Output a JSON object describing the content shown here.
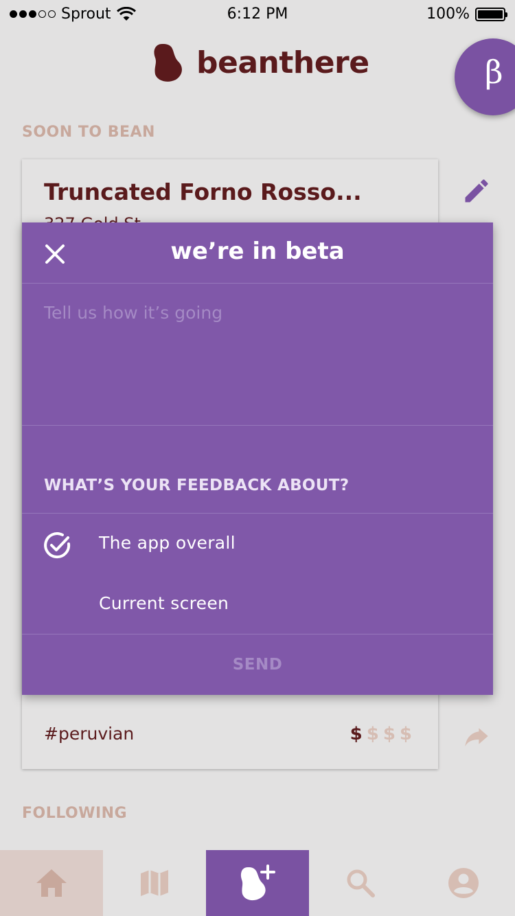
{
  "status_bar": {
    "carrier": "Sprout",
    "time": "6:12 PM",
    "battery": "100%"
  },
  "header": {
    "app_name": "beanthere",
    "beta_badge": "β"
  },
  "sections": {
    "soon_to_bean": "SOON TO BEAN",
    "following": "FOLLOWING"
  },
  "card": {
    "title": "Truncated Forno Rosso...",
    "subtitle": "327 Gold St",
    "tag": "#peruvian",
    "price_level": 1,
    "price_max": 4,
    "price_symbol": "$"
  },
  "feedback_modal": {
    "title": "we’re in beta",
    "input_placeholder": "Tell us how it’s going",
    "input_value": "",
    "question": "WHAT’S YOUR FEEDBACK ABOUT?",
    "options": [
      {
        "label": "The app overall",
        "selected": true
      },
      {
        "label": "Current screen",
        "selected": false
      }
    ],
    "send_label": "SEND"
  },
  "tabbar": {
    "items": [
      {
        "name": "home",
        "icon": "home-icon",
        "selected": true
      },
      {
        "name": "map",
        "icon": "map-icon",
        "selected": false
      },
      {
        "name": "add-bean",
        "icon": "bean-plus-icon",
        "selected": false
      },
      {
        "name": "search",
        "icon": "search-icon",
        "selected": false
      },
      {
        "name": "profile",
        "icon": "account-icon",
        "selected": false
      }
    ]
  },
  "colors": {
    "brand_dark": "#5a1a1c",
    "brand_purple": "#8058a9",
    "muted_label": "#c8a89c",
    "background": "#e2e1e1"
  }
}
